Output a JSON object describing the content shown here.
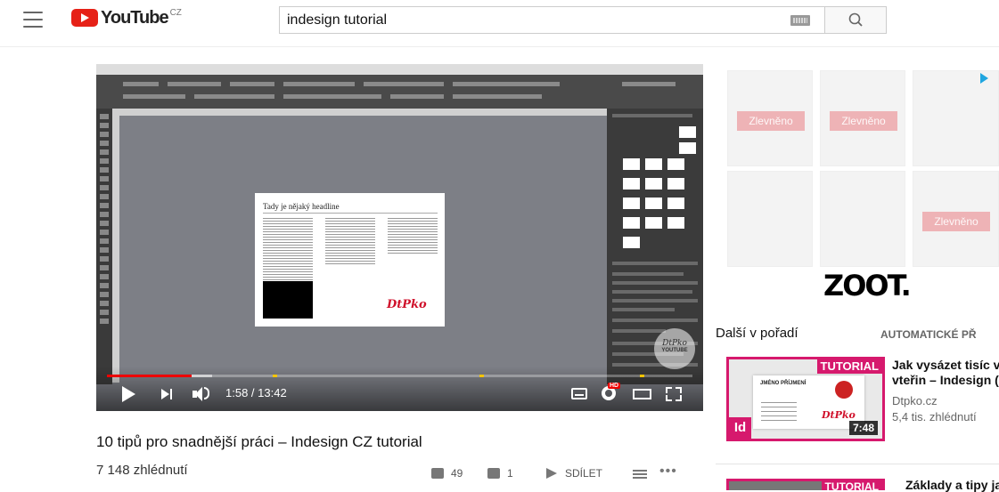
{
  "header": {
    "logo_text": "YouTube",
    "region": "CZ",
    "search_value": "indesign tutorial",
    "icons": [
      "menu-icon",
      "keyboard-icon",
      "search-icon"
    ]
  },
  "video": {
    "screen": {
      "headline": "Tady je nějaký headline",
      "brand_logo": "DtPko",
      "watermark_top": "DtPko",
      "watermark_bottom": "YOUTUBE"
    },
    "time": "1:58 / 13:42",
    "progress": {
      "played": 0.144,
      "buffered": 0.18
    },
    "hd_badge": "HD",
    "accent": "#ff0000"
  },
  "info": {
    "title": "10 tipů pro snadnější práci – Indesign CZ tutorial",
    "views": "7 148 zhlédnutí",
    "likes": "49",
    "dislikes": "1",
    "share_label": "SDÍLET",
    "more": "•••"
  },
  "ad": {
    "brand": "ZOOT.",
    "sale_label": "Zlevněno",
    "colors": {
      "sale": "#e63c46",
      "adchoice": "#20a6e0"
    }
  },
  "sidebar": {
    "next_label": "Další v pořadí",
    "autoplay_label": "AUTOMATICKÉ PŘ",
    "videos": [
      {
        "badge": "TUTORIAL",
        "app_badge": "Id",
        "title_line1": "Jak vysázet tisíc v",
        "title_line2": "vteřin – Indesign (",
        "channel": "Dtpko.cz",
        "views": "5,4 tis. zhlédnutí",
        "duration": "7:48",
        "card_name": "JMÉNO PŘÍJMENÍ",
        "card_logo": "DtPko",
        "card_phone": "000 000 000"
      },
      {
        "badge": "TUTORIAL",
        "title_line1": "Základy a tipy jak"
      }
    ],
    "accent": "#d6196d"
  }
}
